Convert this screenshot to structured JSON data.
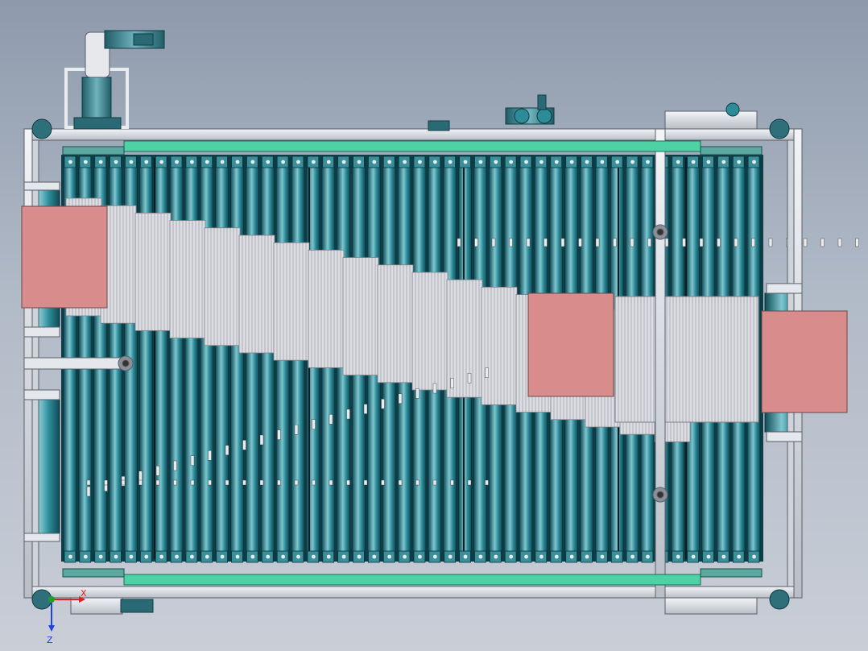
{
  "viewport": {
    "background_top": "#8e9aac",
    "background_bottom": "#c9ced7"
  },
  "colors": {
    "roller_dark": "#0f4b57",
    "roller_mid": "#2e8c99",
    "roller_light": "#7fc6cf",
    "frame": "#d8dce3",
    "frame_edge": "#5a5f68",
    "guide_green": "#4fd1a6",
    "carton_face": "#dcdde2",
    "carton_line": "#7d8088",
    "product_box": "#d98c8c",
    "product_edge": "#6a4a4a",
    "axis_x": "#e02020",
    "axis_y": "#20a020",
    "axis_z": "#2040e0"
  },
  "triad": {
    "x_label": "X",
    "z_label": "Z",
    "icon": "coordinate-triad-icon"
  },
  "assembly": {
    "roller_count": 46,
    "cartons_in_diagonal_transfer": 18,
    "product_boxes": 3,
    "icons": [
      "motor-icon",
      "gearbox-icon",
      "roller-icon",
      "chain-icon",
      "pulley-icon",
      "guide-rail-icon",
      "bearing-icon"
    ]
  }
}
